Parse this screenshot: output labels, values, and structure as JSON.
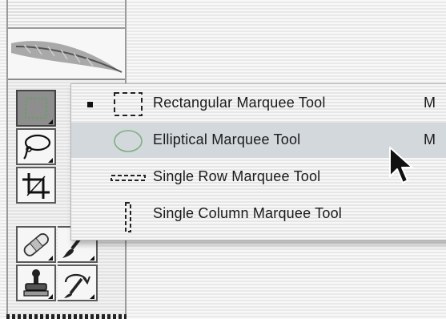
{
  "palette": {
    "tools": [
      {
        "name": "marquee-tool",
        "icon": "marquee-icon",
        "active": true
      },
      {
        "name": "lasso-tool",
        "icon": "lasso-icon"
      },
      {
        "name": "crop-tool",
        "icon": "crop-icon"
      },
      {
        "name": "healing-brush-tool",
        "icon": "bandage-icon"
      },
      {
        "name": "brush-tool",
        "icon": "brush-icon"
      },
      {
        "name": "clone-stamp-tool",
        "icon": "stamp-icon"
      },
      {
        "name": "history-brush-tool",
        "icon": "history-brush-icon"
      }
    ],
    "logo": "feather-icon"
  },
  "flyout": {
    "items": [
      {
        "label": "Rectangular Marquee Tool",
        "shortcut": "M",
        "icon": "rectangular-marquee-icon",
        "selected": true
      },
      {
        "label": "Elliptical Marquee Tool",
        "shortcut": "M",
        "icon": "elliptical-marquee-icon",
        "highlighted": true
      },
      {
        "label": "Single Row Marquee Tool",
        "shortcut": "",
        "icon": "single-row-marquee-icon"
      },
      {
        "label": "Single Column Marquee Tool",
        "shortcut": "",
        "icon": "single-column-marquee-icon"
      }
    ]
  },
  "colors": {
    "highlight": "#d3d8dd",
    "active_tool": "#8e8e8e",
    "ellipse_stroke": "#7fb07f"
  }
}
